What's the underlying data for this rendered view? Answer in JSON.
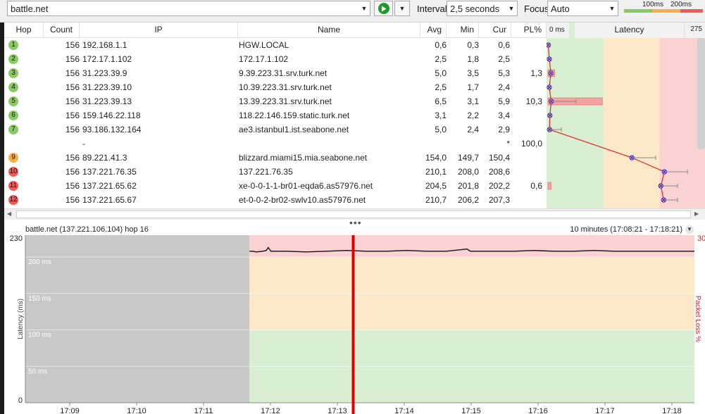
{
  "toolbar": {
    "target": "battle.net",
    "interval_label": "Interval",
    "interval_value": "2,5 seconds",
    "focus_label": "Focus",
    "focus_value": "Auto",
    "legend_100": "100ms",
    "legend_200": "200ms"
  },
  "colors": {
    "good": "#d9efd2",
    "warn": "#fde9c8",
    "bad": "#fad2d2",
    "badge_green": "#8bc965",
    "badge_orange": "#f5b04a",
    "badge_red": "#ef5a5a",
    "lat_line": "#e52020",
    "cursor": "#dd0000",
    "history_gray": "#c8c8c8"
  },
  "table": {
    "headers": {
      "hop": "Hop",
      "count": "Count",
      "ip": "IP",
      "name": "Name",
      "avg": "Avg",
      "min": "Min",
      "cur": "Cur",
      "pl": "PL%",
      "lat_min": "0 ms",
      "latency": "Latency",
      "lat_max": "275"
    },
    "rows": [
      {
        "hop": "1",
        "status": "green",
        "count": "156",
        "ip": "192.168.1.1",
        "name": "HGW.LOCAL",
        "avg": "0,6",
        "min": "0,3",
        "cur": "0,6",
        "pl": ""
      },
      {
        "hop": "2",
        "status": "green",
        "count": "156",
        "ip": "172.17.1.102",
        "name": "172.17.1.102",
        "avg": "2,5",
        "min": "1,8",
        "cur": "2,5",
        "pl": ""
      },
      {
        "hop": "3",
        "status": "green",
        "count": "156",
        "ip": "31.223.39.9",
        "name": "9.39.223.31.srv.turk.net",
        "avg": "5,0",
        "min": "3,5",
        "cur": "5,3",
        "pl": "1,3"
      },
      {
        "hop": "4",
        "status": "green",
        "count": "156",
        "ip": "31.223.39.10",
        "name": "10.39.223.31.srv.turk.net",
        "avg": "2,5",
        "min": "1,7",
        "cur": "2,4",
        "pl": ""
      },
      {
        "hop": "5",
        "status": "green",
        "count": "156",
        "ip": "31.223.39.13",
        "name": "13.39.223.31.srv.turk.net",
        "avg": "6,5",
        "min": "3,1",
        "cur": "5,9",
        "pl": "10,3"
      },
      {
        "hop": "6",
        "status": "green",
        "count": "156",
        "ip": "159.146.22.118",
        "name": "118.22.146.159.static.turk.net",
        "avg": "3,1",
        "min": "2,2",
        "cur": "3,4",
        "pl": ""
      },
      {
        "hop": "7",
        "status": "green",
        "count": "156",
        "ip": "93.186.132.164",
        "name": "ae3.istanbul1.ist.seabone.net",
        "avg": "5,0",
        "min": "2,4",
        "cur": "2,9",
        "pl": ""
      },
      {
        "hop": "",
        "status": "none",
        "count": "",
        "ip": "-",
        "name": "",
        "avg": "",
        "min": "",
        "cur": "*",
        "pl": "100,0"
      },
      {
        "hop": "9",
        "status": "orange",
        "count": "156",
        "ip": "89.221.41.3",
        "name": "blizzard.miami15.mia.seabone.net",
        "avg": "154,0",
        "min": "149,7",
        "cur": "150,4",
        "pl": ""
      },
      {
        "hop": "10",
        "status": "red",
        "count": "156",
        "ip": "137.221.76.35",
        "name": "137.221.76.35",
        "avg": "210,1",
        "min": "208,0",
        "cur": "208,6",
        "pl": ""
      },
      {
        "hop": "11",
        "status": "red",
        "count": "156",
        "ip": "137.221.65.62",
        "name": "xe-0-0-1-1-br01-eqda6.as57976.net",
        "avg": "204,5",
        "min": "201,8",
        "cur": "202,2",
        "pl": "0,6"
      },
      {
        "hop": "12",
        "status": "red",
        "count": "156",
        "ip": "137.221.65.67",
        "name": "et-0-0-2-br02-swlv10.as57976.net",
        "avg": "210,7",
        "min": "206,2",
        "cur": "207,3",
        "pl": ""
      }
    ]
  },
  "latency_scale": {
    "min": 0,
    "max": 275,
    "warn": 100,
    "bad": 200
  },
  "latency_points": [
    {
      "cur": 0.6,
      "avg": 0.6,
      "max": 0.9,
      "pl": 0
    },
    {
      "cur": 2.5,
      "avg": 2.5,
      "max": 2.9,
      "pl": 0
    },
    {
      "cur": 5.3,
      "avg": 5.0,
      "max": 6.0,
      "pl": 1.3
    },
    {
      "cur": 2.4,
      "avg": 2.5,
      "max": 3.0,
      "pl": 0
    },
    {
      "cur": 5.9,
      "avg": 6.5,
      "max": 50.0,
      "pl": 10.3
    },
    {
      "cur": 3.4,
      "avg": 3.1,
      "max": 4.0,
      "pl": 0
    },
    {
      "cur": 2.9,
      "avg": 5.0,
      "max": 24.0,
      "pl": 0
    },
    null,
    {
      "cur": 150.4,
      "avg": 154.0,
      "max": 193.0,
      "pl": 0
    },
    {
      "cur": 208.6,
      "avg": 210.1,
      "max": 250.0,
      "pl": 0
    },
    {
      "cur": 202.2,
      "avg": 204.5,
      "max": 232.0,
      "pl": 0.6
    },
    {
      "cur": 207.3,
      "avg": 210.7,
      "max": 232.0,
      "pl": 0
    }
  ],
  "timechart": {
    "title": "battle.net (137.221.106.104) hop 16",
    "range_label": "10 minutes (17:08:21 - 17:18:21)",
    "y_label": "Latency (ms)",
    "y2_label": "Packet Loss %",
    "y_max_label": "230",
    "y_min_label": "0",
    "y2_max_label": "30",
    "y_gridlines": [
      {
        "value": 200,
        "label": "200 ms"
      },
      {
        "value": 150,
        "label": "150 ms"
      },
      {
        "value": 100,
        "label": "100 ms"
      },
      {
        "value": 50,
        "label": "50 ms"
      }
    ],
    "x_ticks": [
      "17:09",
      "17:10",
      "17:11",
      "17:12",
      "17:13",
      "17:14",
      "17:15",
      "17:16",
      "17:17",
      "17:18"
    ],
    "y_max": 230,
    "zones": {
      "warn": 100,
      "bad": 200
    },
    "series": [
      {
        "t": 0.335,
        "v": 208
      },
      {
        "t": 0.34,
        "v": 208
      },
      {
        "t": 0.345,
        "v": 207
      },
      {
        "t": 0.355,
        "v": 208
      },
      {
        "t": 0.36,
        "v": 209
      },
      {
        "t": 0.363,
        "v": 213
      },
      {
        "t": 0.367,
        "v": 208
      },
      {
        "t": 0.39,
        "v": 208
      },
      {
        "t": 0.42,
        "v": 207
      },
      {
        "t": 0.45,
        "v": 208
      },
      {
        "t": 0.48,
        "v": 209
      },
      {
        "t": 0.51,
        "v": 208
      },
      {
        "t": 0.54,
        "v": 208
      },
      {
        "t": 0.57,
        "v": 209
      },
      {
        "t": 0.6,
        "v": 208
      },
      {
        "t": 0.63,
        "v": 208
      },
      {
        "t": 0.66,
        "v": 211
      },
      {
        "t": 0.665,
        "v": 208
      },
      {
        "t": 0.7,
        "v": 208
      },
      {
        "t": 0.73,
        "v": 208
      },
      {
        "t": 0.76,
        "v": 209
      },
      {
        "t": 0.79,
        "v": 208
      },
      {
        "t": 0.82,
        "v": 208
      },
      {
        "t": 0.85,
        "v": 209
      },
      {
        "t": 0.88,
        "v": 208
      },
      {
        "t": 0.91,
        "v": 208
      },
      {
        "t": 0.94,
        "v": 208
      },
      {
        "t": 0.97,
        "v": 208
      },
      {
        "t": 1.0,
        "v": 208
      }
    ],
    "history_start": 0.335,
    "cursor_at": 0.49
  }
}
